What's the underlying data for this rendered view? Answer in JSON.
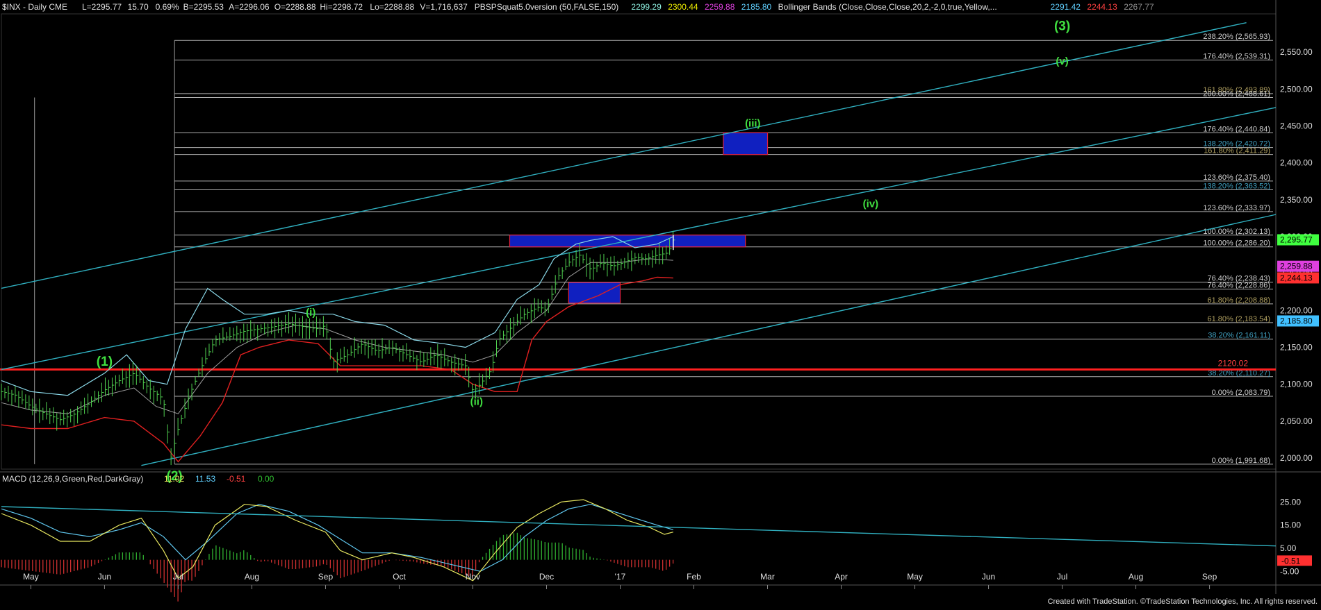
{
  "header": {
    "symbol": "$INX - Daily  CME",
    "stats": [
      {
        "label": "L=2295.77",
        "color": "#e0e0e0"
      },
      {
        "label": "15.70",
        "color": "#e0e0e0"
      },
      {
        "label": "0.69%",
        "color": "#e0e0e0"
      },
      {
        "label": "B=2295.53",
        "color": "#e0e0e0"
      },
      {
        "label": "A=2296.06",
        "color": "#e0e0e0"
      },
      {
        "label": "O=2288.88",
        "color": "#e0e0e0"
      },
      {
        "label": "Hi=2298.72",
        "color": "#e0e0e0"
      },
      {
        "label": "Lo=2288.88",
        "color": "#e0e0e0"
      },
      {
        "label": "V=1,716,637",
        "color": "#e0e0e0"
      },
      {
        "label": "PBSPSquat5.0version (50,FALSE,150)",
        "color": "#e0e0e0"
      },
      {
        "label": "2299.29",
        "color": "#8ef0e0"
      },
      {
        "label": "2300.44",
        "color": "#f0f000"
      },
      {
        "label": "2259.88",
        "color": "#e040e0"
      },
      {
        "label": "2185.80",
        "color": "#60d0ff"
      },
      {
        "label": "Bollinger Bands (Close,Close,Close,20,2,-2,0,true,Yellow,...",
        "color": "#e0e0e0"
      },
      {
        "label": "2291.42",
        "color": "#60d0ff"
      },
      {
        "label": "2244.13",
        "color": "#ff4040"
      },
      {
        "label": "2267.77",
        "color": "#909090"
      }
    ]
  },
  "macd_header": {
    "label": "MACD (12,26,9,Green,Red,DarkGray)",
    "values": [
      {
        "label": "11.02",
        "color": "#f0f060"
      },
      {
        "label": "11.53",
        "color": "#60d0ff"
      },
      {
        "label": "-0.51",
        "color": "#ff4040"
      },
      {
        "label": "0.00",
        "color": "#30c030"
      }
    ]
  },
  "footer": "Created with TradeStation. ©TradeStation Technologies, Inc. All rights reserved.",
  "chart_data": [
    {
      "type": "line",
      "chart": "price",
      "y_ticks": [
        2000,
        2050,
        2100,
        2150,
        2200,
        2250,
        2300,
        2350,
        2400,
        2450,
        2500,
        2550
      ],
      "y_tick_labels": [
        "2,000.00",
        "2,050.00",
        "2,100.00",
        "2,150.00",
        "2,200.00",
        "2,250.00",
        "2,300.00",
        "2,350.00",
        "2,400.00",
        "2,450.00",
        "2,500.00",
        "2,550.00"
      ],
      "ylim": [
        1985,
        2600
      ],
      "x_labels": [
        "May",
        "Jun",
        "Jul",
        "Aug",
        "Sep",
        "Oct",
        "Nov",
        "Dec",
        "'17",
        "Feb",
        "Mar",
        "Apr",
        "May",
        "Jun",
        "Jul",
        "Aug",
        "Sep"
      ],
      "x_label_months": [
        0,
        1,
        2,
        3,
        4,
        5,
        6,
        7,
        8,
        9,
        10,
        11,
        12,
        13,
        14,
        15,
        16
      ],
      "xlim_months": [
        -0.4,
        16.9
      ],
      "price_path": [
        [
          -0.4,
          2090
        ],
        [
          -0.2,
          2085
        ],
        [
          0.0,
          2070
        ],
        [
          0.2,
          2060
        ],
        [
          0.4,
          2052
        ],
        [
          0.6,
          2060
        ],
        [
          0.8,
          2075
        ],
        [
          1.0,
          2092
        ],
        [
          1.2,
          2105
        ],
        [
          1.4,
          2115
        ],
        [
          1.6,
          2095
        ],
        [
          1.8,
          2080
        ],
        [
          1.9,
          2000
        ],
        [
          2.0,
          2040
        ],
        [
          2.15,
          2085
        ],
        [
          2.3,
          2120
        ],
        [
          2.5,
          2160
        ],
        [
          2.7,
          2165
        ],
        [
          2.9,
          2172
        ],
        [
          3.1,
          2175
        ],
        [
          3.3,
          2178
        ],
        [
          3.5,
          2182
        ],
        [
          3.7,
          2178
        ],
        [
          3.9,
          2175
        ],
        [
          4.0,
          2180
        ],
        [
          4.1,
          2130
        ],
        [
          4.3,
          2140
        ],
        [
          4.5,
          2155
        ],
        [
          4.7,
          2145
        ],
        [
          4.9,
          2150
        ],
        [
          5.1,
          2140
        ],
        [
          5.3,
          2130
        ],
        [
          5.5,
          2140
        ],
        [
          5.7,
          2130
        ],
        [
          5.9,
          2125
        ],
        [
          6.0,
          2090
        ],
        [
          6.1,
          2100
        ],
        [
          6.25,
          2120
        ],
        [
          6.35,
          2160
        ],
        [
          6.5,
          2175
        ],
        [
          6.7,
          2195
        ],
        [
          6.9,
          2205
        ],
        [
          7.0,
          2200
        ],
        [
          7.15,
          2245
        ],
        [
          7.3,
          2265
        ],
        [
          7.45,
          2275
        ],
        [
          7.6,
          2255
        ],
        [
          7.75,
          2265
        ],
        [
          7.9,
          2260
        ],
        [
          8.05,
          2265
        ],
        [
          8.2,
          2272
        ],
        [
          8.35,
          2270
        ],
        [
          8.5,
          2275
        ],
        [
          8.65,
          2278
        ],
        [
          8.72,
          2296
        ]
      ],
      "bollinger_upper": [
        [
          -0.4,
          2105
        ],
        [
          0.0,
          2090
        ],
        [
          0.5,
          2085
        ],
        [
          1.0,
          2115
        ],
        [
          1.3,
          2140
        ],
        [
          1.6,
          2105
        ],
        [
          1.85,
          2100
        ],
        [
          2.1,
          2175
        ],
        [
          2.4,
          2230
        ],
        [
          2.6,
          2215
        ],
        [
          2.9,
          2195
        ],
        [
          3.2,
          2195
        ],
        [
          3.5,
          2200
        ],
        [
          3.8,
          2195
        ],
        [
          4.1,
          2195
        ],
        [
          4.4,
          2185
        ],
        [
          4.8,
          2180
        ],
        [
          5.2,
          2160
        ],
        [
          5.6,
          2155
        ],
        [
          5.9,
          2150
        ],
        [
          6.3,
          2170
        ],
        [
          6.6,
          2215
        ],
        [
          6.9,
          2235
        ],
        [
          7.1,
          2270
        ],
        [
          7.4,
          2290
        ],
        [
          7.6,
          2295
        ],
        [
          7.9,
          2300
        ],
        [
          8.2,
          2285
        ],
        [
          8.5,
          2290
        ],
        [
          8.72,
          2300
        ]
      ],
      "bollinger_middle": [
        [
          -0.4,
          2075
        ],
        [
          0.0,
          2065
        ],
        [
          0.5,
          2060
        ],
        [
          1.0,
          2085
        ],
        [
          1.4,
          2095
        ],
        [
          1.7,
          2070
        ],
        [
          2.0,
          2060
        ],
        [
          2.4,
          2115
        ],
        [
          2.8,
          2150
        ],
        [
          3.2,
          2170
        ],
        [
          3.6,
          2180
        ],
        [
          4.0,
          2175
        ],
        [
          4.4,
          2160
        ],
        [
          4.8,
          2150
        ],
        [
          5.2,
          2145
        ],
        [
          5.6,
          2140
        ],
        [
          6.0,
          2130
        ],
        [
          6.3,
          2140
        ],
        [
          6.6,
          2170
        ],
        [
          7.0,
          2200
        ],
        [
          7.3,
          2245
        ],
        [
          7.6,
          2265
        ],
        [
          8.0,
          2265
        ],
        [
          8.4,
          2270
        ],
        [
          8.72,
          2268
        ]
      ],
      "bollinger_lower": [
        [
          -0.4,
          2045
        ],
        [
          0.0,
          2040
        ],
        [
          0.5,
          2040
        ],
        [
          1.0,
          2055
        ],
        [
          1.4,
          2050
        ],
        [
          1.8,
          2020
        ],
        [
          2.0,
          1995
        ],
        [
          2.3,
          2030
        ],
        [
          2.6,
          2075
        ],
        [
          2.85,
          2140
        ],
        [
          3.1,
          2150
        ],
        [
          3.5,
          2160
        ],
        [
          3.9,
          2155
        ],
        [
          4.2,
          2125
        ],
        [
          4.5,
          2125
        ],
        [
          4.9,
          2125
        ],
        [
          5.3,
          2125
        ],
        [
          5.7,
          2120
        ],
        [
          6.0,
          2100
        ],
        [
          6.3,
          2090
        ],
        [
          6.6,
          2090
        ],
        [
          6.8,
          2160
        ],
        [
          7.0,
          2185
        ],
        [
          7.3,
          2205
        ],
        [
          7.7,
          2220
        ],
        [
          8.0,
          2235
        ],
        [
          8.3,
          2240
        ],
        [
          8.5,
          2245
        ],
        [
          8.72,
          2244
        ]
      ],
      "fib_levels": [
        {
          "label": "238.20% (2,565.93)",
          "value": 2565.93
        },
        {
          "label": "176.40% (2,539.31)",
          "value": 2539.31
        },
        {
          "label": "161.80% (2,493.89)",
          "value": 2493.89
        },
        {
          "label": "200.00% (2,488.61)",
          "value": 2488.61
        },
        {
          "label": "176.40% (2,440.84)",
          "value": 2440.84
        },
        {
          "label": "138.20% (2,420.72)",
          "value": 2420.72
        },
        {
          "label": "161.80% (2,411.29)",
          "value": 2411.29
        },
        {
          "label": "123.60% (2,375.40)",
          "value": 2375.4
        },
        {
          "label": "138.20% (2,363.52)",
          "value": 2363.52
        },
        {
          "label": "123.60% (2,333.97)",
          "value": 2333.97
        },
        {
          "label": "100.00% (2,302.13)",
          "value": 2302.13
        },
        {
          "label": "100.00% (2,286.20)",
          "value": 2286.2
        },
        {
          "label": "76.40% (2,238.43)",
          "value": 2238.43
        },
        {
          "label": "76.40% (2,228.86)",
          "value": 2228.86
        },
        {
          "label": "61.80% (2,208.88)",
          "value": 2208.88
        },
        {
          "label": "61.80% (2,183.54)",
          "value": 2183.54
        },
        {
          "label": "38.20% (2,161.11)",
          "value": 2161.11
        },
        {
          "label": "38.20% (2,110.27)",
          "value": 2110.27
        },
        {
          "label": "0.00% (2,083.79)",
          "value": 2083.79
        },
        {
          "label": "0.00% (1,991.68)",
          "value": 1991.68
        }
      ],
      "support_line": {
        "value": 2120.02,
        "label": "2120.02",
        "color": "#ff2020"
      },
      "channel_lines": [
        {
          "from": [
            -0.4,
            2230
          ],
          "to": [
            16.5,
            2590
          ]
        },
        {
          "from": [
            -0.4,
            2120
          ],
          "to": [
            16.9,
            2475
          ]
        },
        {
          "from": [
            1.5,
            1990
          ],
          "to": [
            16.9,
            2330
          ]
        }
      ],
      "target_boxes": [
        {
          "x0": 6.5,
          "x1": 9.7,
          "y0": 2286.2,
          "y1": 2302.13
        },
        {
          "x0": 7.3,
          "x1": 8.0,
          "y0": 2210,
          "y1": 2238
        },
        {
          "x0": 9.4,
          "x1": 10.0,
          "y0": 2411.29,
          "y1": 2440.84
        }
      ],
      "wave_labels": [
        {
          "text": "(1)",
          "x": 1.0,
          "y": 2125,
          "color": "#40e040",
          "big": true
        },
        {
          "text": "(2)",
          "x": 1.95,
          "y": 1970,
          "color": "#40e040",
          "big": true
        },
        {
          "text": "(i)",
          "x": 3.8,
          "y": 2193,
          "color": "#40e040",
          "big": false
        },
        {
          "text": "(ii)",
          "x": 6.05,
          "y": 2072,
          "color": "#40e040",
          "big": false
        },
        {
          "text": "(iii)",
          "x": 9.8,
          "y": 2449,
          "color": "#40e040",
          "big": false
        },
        {
          "text": "(iv)",
          "x": 11.4,
          "y": 2340,
          "color": "#40e040",
          "big": false
        },
        {
          "text": "(v)",
          "x": 14.0,
          "y": 2533,
          "color": "#40e040",
          "big": false
        },
        {
          "text": "(3)",
          "x": 14.0,
          "y": 2580,
          "color": "#40e040",
          "big": true
        }
      ],
      "right_badges": [
        {
          "label": "2,295.77",
          "value": 2295.77,
          "bg": "#40ff40",
          "fg": "#000"
        },
        {
          "label": "2,259.88",
          "value": 2259.88,
          "bg": "#e040e0",
          "fg": "#000"
        },
        {
          "label": "2,244.13",
          "value": 2244.13,
          "bg": "#ff3030",
          "fg": "#000"
        },
        {
          "label": "2,185.80",
          "value": 2185.8,
          "bg": "#40c0ff",
          "fg": "#000"
        }
      ]
    },
    {
      "type": "line",
      "chart": "macd",
      "y_ticks": [
        -5,
        5,
        15,
        25
      ],
      "y_tick_labels": [
        "-5.00",
        "5.00",
        "15.00",
        "25.00"
      ],
      "ylim": [
        -10,
        32
      ],
      "macd_path": [
        [
          -0.4,
          20
        ],
        [
          0.0,
          15
        ],
        [
          0.4,
          8
        ],
        [
          0.8,
          8
        ],
        [
          1.2,
          15
        ],
        [
          1.5,
          18
        ],
        [
          1.8,
          4
        ],
        [
          2.0,
          -8
        ],
        [
          2.2,
          -3
        ],
        [
          2.5,
          15
        ],
        [
          2.9,
          24
        ],
        [
          3.2,
          23
        ],
        [
          3.6,
          17
        ],
        [
          4.0,
          12
        ],
        [
          4.2,
          4
        ],
        [
          4.5,
          0
        ],
        [
          4.9,
          3
        ],
        [
          5.2,
          1
        ],
        [
          5.6,
          -3
        ],
        [
          6.0,
          -9
        ],
        [
          6.3,
          3
        ],
        [
          6.6,
          14
        ],
        [
          6.9,
          20
        ],
        [
          7.2,
          25
        ],
        [
          7.5,
          26
        ],
        [
          7.8,
          22
        ],
        [
          8.1,
          17
        ],
        [
          8.4,
          14
        ],
        [
          8.6,
          11
        ],
        [
          8.72,
          12
        ]
      ],
      "signal_path": [
        [
          -0.4,
          22
        ],
        [
          0.0,
          18
        ],
        [
          0.4,
          12
        ],
        [
          0.8,
          10
        ],
        [
          1.2,
          13
        ],
        [
          1.5,
          16
        ],
        [
          1.8,
          10
        ],
        [
          2.1,
          0
        ],
        [
          2.4,
          8
        ],
        [
          2.8,
          20
        ],
        [
          3.1,
          24
        ],
        [
          3.5,
          21
        ],
        [
          3.9,
          15
        ],
        [
          4.2,
          9
        ],
        [
          4.5,
          3
        ],
        [
          4.9,
          3
        ],
        [
          5.3,
          1
        ],
        [
          5.7,
          -2
        ],
        [
          6.1,
          -5
        ],
        [
          6.4,
          0
        ],
        [
          6.7,
          10
        ],
        [
          7.0,
          17
        ],
        [
          7.3,
          22
        ],
        [
          7.6,
          24
        ],
        [
          7.9,
          21
        ],
        [
          8.2,
          18
        ],
        [
          8.5,
          15
        ],
        [
          8.72,
          13
        ]
      ],
      "trend_line": {
        "from": [
          -0.4,
          23
        ],
        "to": [
          16.9,
          6
        ]
      },
      "zero_value": 0
    }
  ]
}
